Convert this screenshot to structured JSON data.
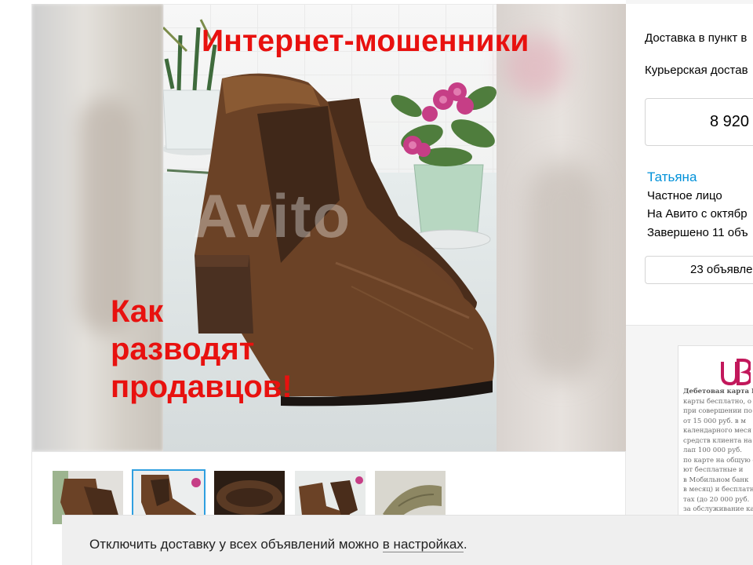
{
  "photo": {
    "headline": "Интернет-мошенники",
    "subhead_lines": [
      "Как",
      "разводят",
      "продавцов!"
    ],
    "watermark": "Avito"
  },
  "thumbnails": [
    {
      "name": "thumb-1",
      "selected": false
    },
    {
      "name": "thumb-2",
      "selected": true
    },
    {
      "name": "thumb-3",
      "selected": false
    },
    {
      "name": "thumb-4",
      "selected": false
    },
    {
      "name": "thumb-5",
      "selected": false
    }
  ],
  "seller_panel": {
    "delivery_pickup": "Доставка в пункт в",
    "delivery_courier": "Курьерская достав",
    "phone_partial": "8 920",
    "seller_name": "Татьяна",
    "seller_type": "Частное лицо",
    "on_avito_since": "На Авито с октябр",
    "completed": "Завершено 11 объ",
    "ads_button": "23 объявле"
  },
  "ad_banner": {
    "lines": [
      "Дебетовая карта Б",
      "карты бесплатно, о",
      "при совершении по",
      "от 15 000 руб. в м",
      "календарного  меся",
      "средств клиента на с",
      "лап 100 000 руб.",
      "по карте на общую с",
      "ют  бесплатные  и",
      "в Мобильном банк",
      "в месяц) и бесплатно",
      "тах (до 20 000 руб.",
      "за обслуживание ка"
    ]
  },
  "notice": {
    "text_before": "Отключить доставку у всех объявлений можно ",
    "link": "в настройках",
    "text_after": "."
  },
  "colors": {
    "headline_red": "#e8110f",
    "seller_link_blue": "#0091d9",
    "thumb_selected_border": "#2f9fe0",
    "ad_logo_magenta": "#c2185b"
  }
}
